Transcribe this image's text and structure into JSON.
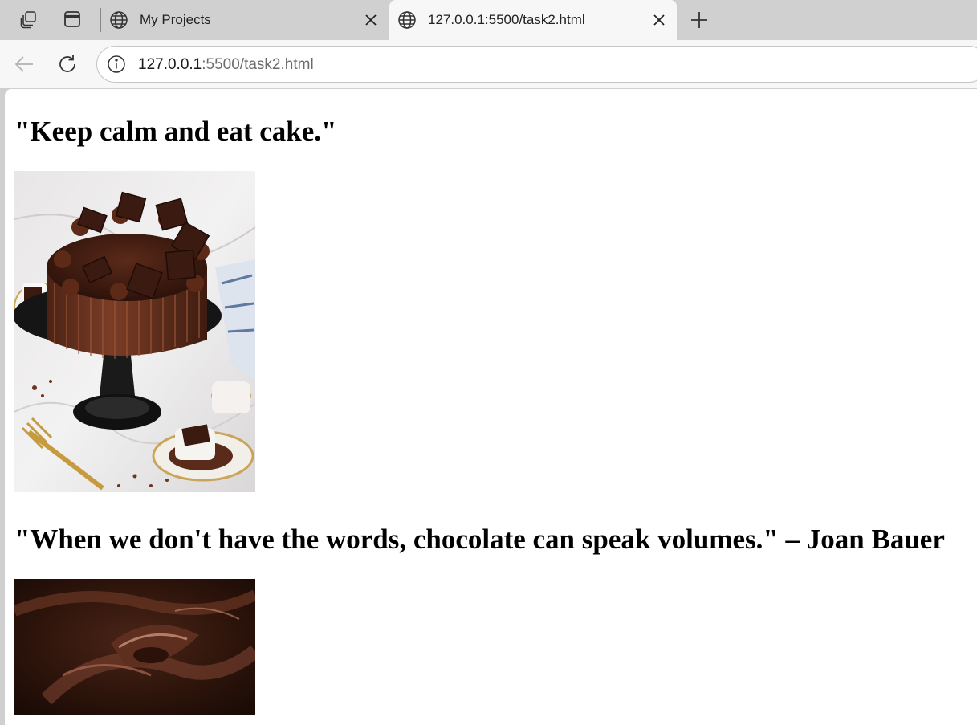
{
  "tabs": [
    {
      "title": "My Projects",
      "active": false
    },
    {
      "title": "127.0.0.1:5500/task2.html",
      "active": true
    }
  ],
  "address_bar": {
    "host": "127.0.0.1",
    "path": ":5500/task2.html"
  },
  "page": {
    "quotes": [
      "\"Keep calm and eat cake.\"",
      "\"When we don't have the words, chocolate can speak volumes.\" – Joan Bauer"
    ],
    "images": [
      {
        "icon": "chocolate-cake-photo"
      },
      {
        "icon": "melted-chocolate-photo"
      }
    ]
  },
  "colors": {
    "tabstrip": "#d0d0d0",
    "toolbar": "#f7f7f7",
    "page": "#ffffff"
  }
}
